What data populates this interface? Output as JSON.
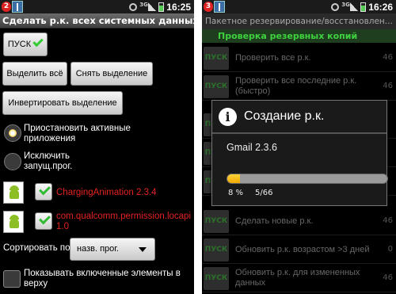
{
  "left": {
    "statusbar": {
      "badge": "2",
      "time": "16:25"
    },
    "title": "Сделать р.к. всех системных данных",
    "start_label": "ПУСК",
    "select_all": "Выделить всё",
    "deselect": "Снять выделение",
    "invert": "Инвертировать выделение",
    "radio_pause": {
      "label": "Приостановить активные приложения",
      "checked": true
    },
    "radio_exclude": {
      "label": "Исключить запущ.прог.",
      "checked": false
    },
    "apps": [
      {
        "name": "ChargingAnimation 2.3.4",
        "checked": true
      },
      {
        "name": "com.qualcomm.permission.locapi 1.0",
        "checked": true
      }
    ],
    "sort_label": "Сортировать по:",
    "sort_value": "назв. прог.",
    "show_enabled_label": "Показывать включенные элементы в верху"
  },
  "right": {
    "statusbar": {
      "badge": "3",
      "time": "16:26"
    },
    "title": "Пакетное резервирование/восстановлен...",
    "section_header": "Проверка резервных копий",
    "go_label": "ПУСК",
    "rows": [
      {
        "text": "Проверить все р.к.",
        "count": "46"
      },
      {
        "text": "Проверить все последние р.к. (быстро)",
        "count": "46"
      },
      {
        "text": "",
        "count": ""
      },
      {
        "text": "",
        "count": ""
      },
      {
        "text": "",
        "count": ""
      },
      {
        "text": "Сделать новые р.к.",
        "count": "46"
      },
      {
        "text": "Обновить р.к. возрастом >3 дней",
        "count": "0"
      },
      {
        "text": "Обновить р.к. для измененных данных",
        "count": "46"
      }
    ],
    "dialog": {
      "title": "Создание р.к.",
      "app": "Gmail 2.3.6",
      "progress_percent": 8,
      "progress_label": "8 %",
      "count_label": "5/66"
    }
  },
  "colors": {
    "accent_green": "#3fd23f",
    "red_text": "#e52222",
    "progress": "#f0a800"
  }
}
